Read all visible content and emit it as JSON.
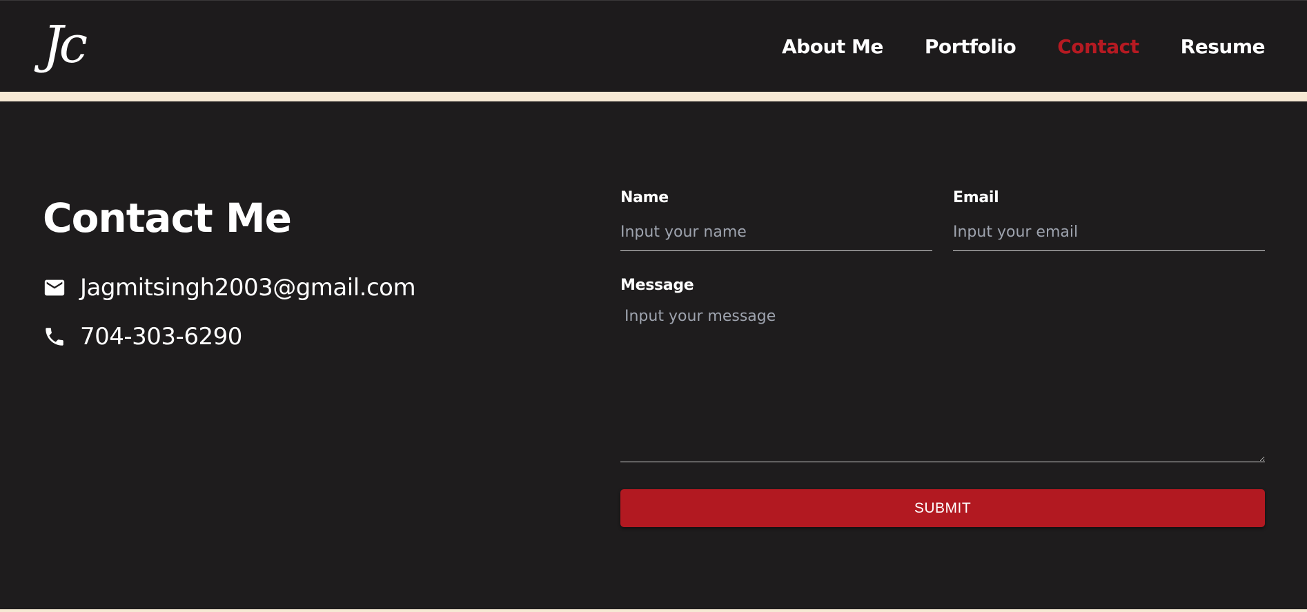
{
  "header": {
    "logo_text": "Jc",
    "nav": [
      {
        "label": "About Me",
        "active": false
      },
      {
        "label": "Portfolio",
        "active": false
      },
      {
        "label": "Contact",
        "active": true
      },
      {
        "label": "Resume",
        "active": false
      }
    ]
  },
  "contact": {
    "title": "Contact Me",
    "email": {
      "icon": "mail-icon",
      "text": "Jagmitsingh2003@gmail.com"
    },
    "phone": {
      "icon": "phone-icon",
      "text": "704-303-6290"
    }
  },
  "form": {
    "name": {
      "label": "Name",
      "placeholder": "Input your name",
      "value": ""
    },
    "email": {
      "label": "Email",
      "placeholder": "Input your email",
      "value": ""
    },
    "message": {
      "label": "Message",
      "placeholder": "Input your message",
      "value": ""
    },
    "submit_label": "SUBMIT"
  },
  "colors": {
    "background": "#1e1c1d",
    "accent": "#b21921",
    "stripe": "#f6e9d4"
  }
}
